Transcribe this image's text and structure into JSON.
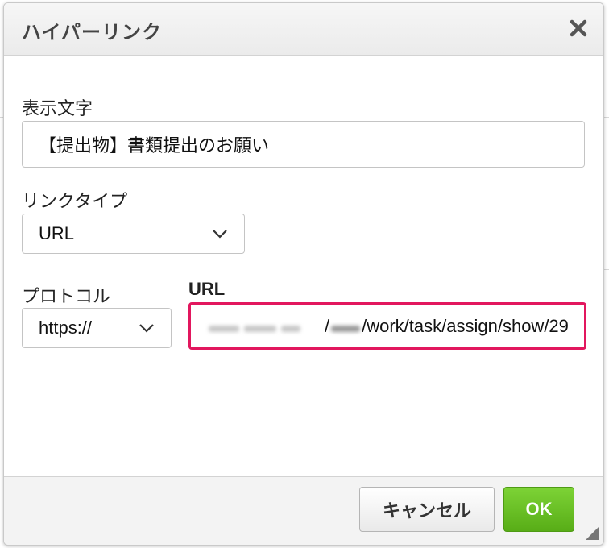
{
  "dialog": {
    "title": "ハイパーリンク",
    "display_text_label": "表示文字",
    "display_text_value": "【提出物】書類提出のお願い",
    "link_type_label": "リンクタイプ",
    "link_type_value": "URL",
    "protocol_label": "プロトコル",
    "protocol_value": "https://",
    "url_label": "URL",
    "url_value_visible": "/work/task/assign/show/29",
    "cancel_label": "キャンセル",
    "ok_label": "OK"
  },
  "colors": {
    "url_highlight": "#e2175e",
    "ok_button": "#6cc224"
  },
  "icons": {
    "close": "close-icon",
    "select_arrow": "chevron-down-icon",
    "resize": "resize-grip-icon"
  }
}
